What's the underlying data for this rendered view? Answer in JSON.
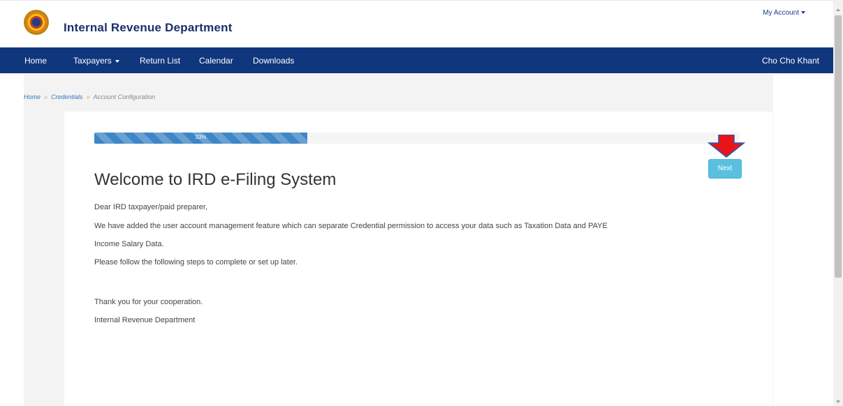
{
  "header": {
    "brand": "Internal Revenue Department",
    "my_account": "My Account"
  },
  "nav": {
    "items": [
      {
        "label": "Home"
      },
      {
        "label": "Taxpayers"
      },
      {
        "label": "Return List"
      },
      {
        "label": "Calendar"
      },
      {
        "label": "Downloads"
      }
    ],
    "user": "Cho Cho Khant"
  },
  "breadcrumb": [
    "Home",
    "Credentials",
    "Account Configuration"
  ],
  "progress": {
    "percent": 33,
    "label": "33%"
  },
  "next_button": "Next",
  "welcome": {
    "title": "Welcome to IRD e-Filing System",
    "lines": [
      "Dear IRD taxpayer/paid preparer,",
      "We have added the user account management feature which can separate Credential permission to access your data such as Taxation Data and PAYE",
      "Income Salary Data.",
      "Please follow the following steps to complete or set up later.",
      "Thank you for your cooperation.",
      "Internal Revenue Department"
    ]
  },
  "colors": {
    "navbar": "#10367d",
    "progress": "#3e86c5",
    "next_button": "#5bc0de",
    "arrow": "#e8141a"
  },
  "icons": [
    "ird-logo-icon",
    "caret-down-icon",
    "red-down-arrow-icon"
  ]
}
